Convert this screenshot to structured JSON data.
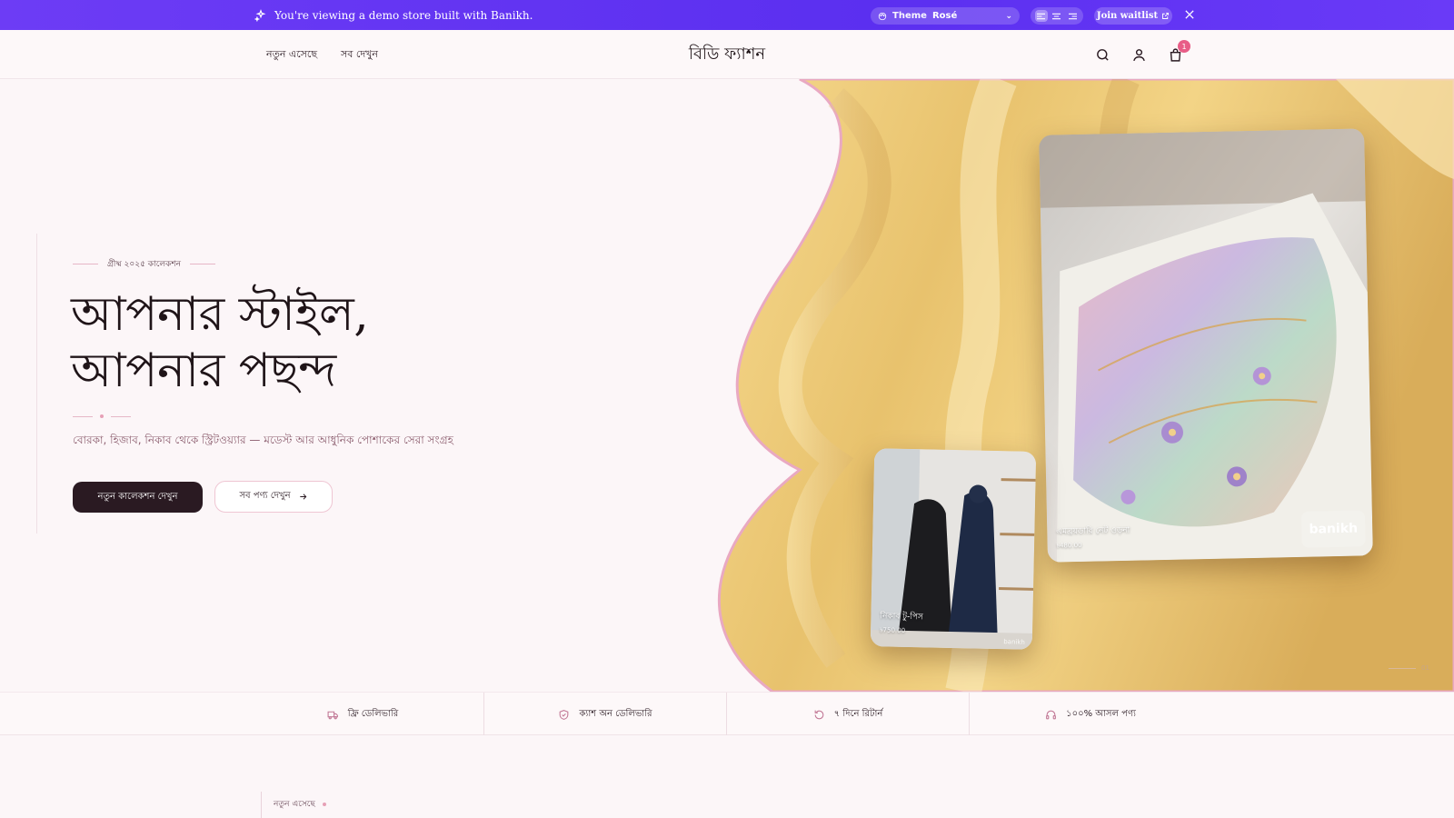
{
  "banner": {
    "message": "You're viewing a demo store built with Banikh.",
    "theme_label": "Theme",
    "theme_value": "Rosé",
    "waitlist_label": "Join waitlist"
  },
  "header": {
    "nav": [
      "নতুন এসেছে",
      "সব দেখুন"
    ],
    "brand": "বিডি ফ্যাশন",
    "cart_count": "1"
  },
  "hero": {
    "eyebrow": "গ্রীষ্ম ২০২৫ কালেকশন",
    "headline_line1": "আপনার স্টাইল,",
    "headline_line2": "আপনার পছন্দ",
    "subtitle": "বোরকা, হিজাব, নিকাব থেকে স্ট্রিটওয়্যার — মডেস্ট আর আধুনিক পোশাকের সেরা সংগ্রহ",
    "cta_primary": "নতুন কালেকশন দেখুন",
    "cta_secondary": "সব পণ্য দেখুন",
    "card_big": {
      "title": "এমব্রয়ডারি নেট ওড়না",
      "price": "৳480.00",
      "logo": "banikh"
    },
    "card_small": {
      "title": "নিকাব টু-পিস",
      "price": "৳750.00",
      "watermark": "banikh"
    },
    "slide_index": "01"
  },
  "features": [
    {
      "label": "ফ্রি ডেলিভারি",
      "icon": "truck-icon"
    },
    {
      "label": "ক্যাশ অন ডেলিভারি",
      "icon": "shield-check-icon"
    },
    {
      "label": "৭ দিনে রিটার্ন",
      "icon": "refresh-icon"
    },
    {
      "label": "১০০% আসল পণ্য",
      "icon": "headphones-icon"
    }
  ],
  "section": {
    "label": "নতুন এসেছে"
  },
  "colors": {
    "banner": "#5b2ff0",
    "accent": "#e85d87",
    "dark": "#2a1a22",
    "background": "#fcf6f8",
    "silk": "#e9c777"
  }
}
